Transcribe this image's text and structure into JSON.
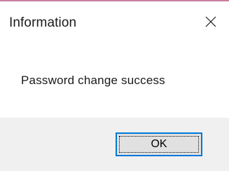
{
  "dialog": {
    "title": "Information",
    "message": "Password change success",
    "ok_label": "OK",
    "close_icon": "close-icon",
    "accent_color": "#0078d7"
  }
}
